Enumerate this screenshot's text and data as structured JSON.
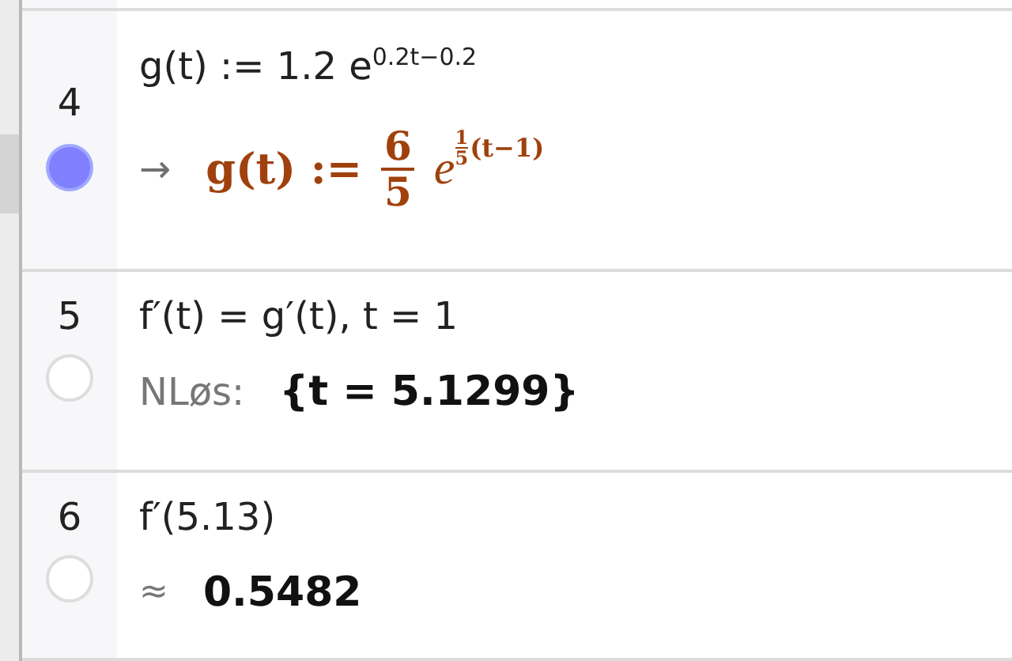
{
  "rows": [
    {
      "number": "4",
      "selected": true,
      "input": "g(t) := 1.2 e$^{0.2t−0.2}$",
      "output": {
        "kind": "definition",
        "arrow": "→",
        "lhs": "g(t) :=",
        "num": "6",
        "den": "5",
        "base": "e",
        "exp_num": "1",
        "exp_den": "5",
        "exp_rest": "(t−1)"
      }
    },
    {
      "number": "5",
      "selected": false,
      "input": "f′(t) = g′(t), t = 1",
      "output": {
        "kind": "labelled",
        "label": "NLøs:",
        "value": "{t = 5.1299}"
      }
    },
    {
      "number": "6",
      "selected": false,
      "input": "f′(5.13)",
      "output": {
        "kind": "approx",
        "symbol": "≈",
        "value": "0.5482"
      }
    }
  ]
}
